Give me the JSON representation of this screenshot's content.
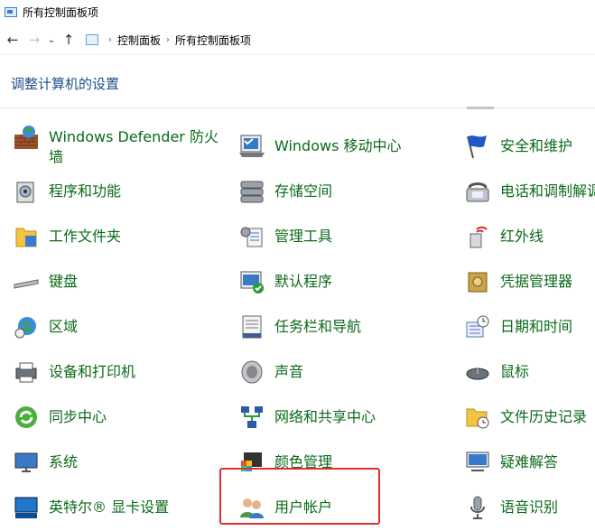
{
  "window": {
    "title": "所有控制面板项"
  },
  "nav": {
    "back_icon": "back-arrow-icon",
    "forward_icon": "forward-arrow-icon",
    "recent_icon": "chevron-down-icon",
    "up_icon": "up-arrow-icon"
  },
  "address": {
    "crumbs": [
      "控制面板",
      "所有控制面板项"
    ]
  },
  "heading": "调整计算机的设置",
  "items": [
    {
      "label": "Windows Defender 防火墙",
      "icon": "firewall-icon"
    },
    {
      "label": "Windows 移动中心",
      "icon": "mobility-center-icon"
    },
    {
      "label": "安全和维护",
      "icon": "security-flag-icon"
    },
    {
      "label": "程序和功能",
      "icon": "programs-icon"
    },
    {
      "label": "存储空间",
      "icon": "storage-spaces-icon"
    },
    {
      "label": "电话和调制解调器",
      "icon": "phone-modem-icon"
    },
    {
      "label": "工作文件夹",
      "icon": "work-folders-icon"
    },
    {
      "label": "管理工具",
      "icon": "admin-tools-icon"
    },
    {
      "label": "红外线",
      "icon": "infrared-icon"
    },
    {
      "label": "键盘",
      "icon": "keyboard-icon"
    },
    {
      "label": "默认程序",
      "icon": "default-programs-icon"
    },
    {
      "label": "凭据管理器",
      "icon": "credential-manager-icon"
    },
    {
      "label": "区域",
      "icon": "region-globe-icon"
    },
    {
      "label": "任务栏和导航",
      "icon": "taskbar-icon"
    },
    {
      "label": "日期和时间",
      "icon": "date-time-icon"
    },
    {
      "label": "设备和打印机",
      "icon": "printer-icon"
    },
    {
      "label": "声音",
      "icon": "speaker-icon"
    },
    {
      "label": "鼠标",
      "icon": "mouse-icon"
    },
    {
      "label": "同步中心",
      "icon": "sync-center-icon"
    },
    {
      "label": "网络和共享中心",
      "icon": "network-icon"
    },
    {
      "label": "文件历史记录",
      "icon": "file-history-icon"
    },
    {
      "label": "系统",
      "icon": "system-monitor-icon"
    },
    {
      "label": "颜色管理",
      "icon": "color-management-icon"
    },
    {
      "label": "疑难解答",
      "icon": "troubleshooting-icon"
    },
    {
      "label": "英特尔® 显卡设置",
      "icon": "intel-graphics-icon"
    },
    {
      "label": "用户帐户",
      "icon": "user-accounts-icon"
    },
    {
      "label": "语音识别",
      "icon": "microphone-icon"
    }
  ],
  "colors": {
    "link_green": "#0b6a1a",
    "heading_blue": "#1e4e8c",
    "highlight_red": "#e03030"
  }
}
